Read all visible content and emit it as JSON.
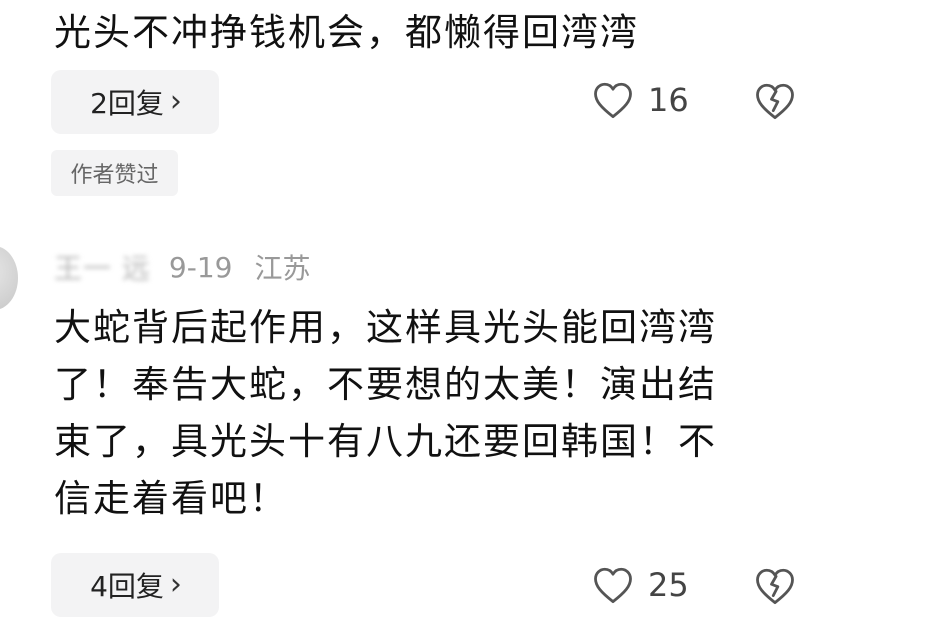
{
  "comment1": {
    "text": "光头不冲挣钱机会，都懒得回湾湾",
    "reply_label": "2回复",
    "reply_chevron": "›",
    "like_count": "16",
    "author_liked_badge": "作者赞过"
  },
  "comment2": {
    "username": "王一 远",
    "date": "9-19",
    "location": "江苏",
    "lines": [
      "大蛇背后起作用，这样具光头能回湾湾",
      "了！奉告大蛇，不要想的太美！演出结",
      "束了，具光头十有八九还要回韩国！不",
      "信走着看吧！"
    ],
    "reply_label": "4回复",
    "reply_chevron": "›",
    "like_count": "25"
  },
  "icons": {
    "like": "heart-outline-icon",
    "dislike": "broken-heart-icon"
  },
  "colors": {
    "text": "#111111",
    "muted": "#999999",
    "button_bg": "#f3f3f4",
    "icon": "#555555"
  }
}
